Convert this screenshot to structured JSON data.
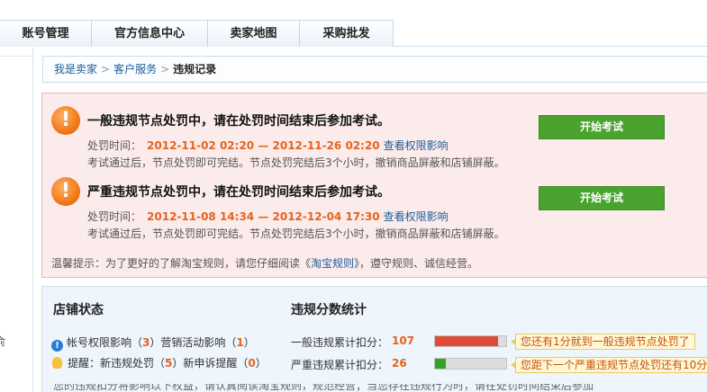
{
  "tabs": [
    "账号管理",
    "官方信息中心",
    "卖家地图",
    "采购批发"
  ],
  "sidebar": {
    "fragment": "俞"
  },
  "breadcrumb": {
    "items": [
      "我是卖家",
      "客户服务"
    ],
    "current": "违规记录",
    "separator": ">"
  },
  "alerts": [
    {
      "title": "一般违规节点处罚中，请在处罚时间结束后参加考试。",
      "time_label": "处罚时间：",
      "time_value": "2012-11-02 02:20 — 2012-11-26 02:20",
      "link": "查看权限影响",
      "desc": "考试通过后，节点处罚即可完结。节点处罚完结后3个小时，撤销商品屏蔽和店铺屏蔽。",
      "button": "开始考试"
    },
    {
      "title": "严重违规节点处罚中，请在处罚时间结束后参加考试。",
      "time_label": "处罚时间：",
      "time_value": "2012-11-08 14:34 — 2012-12-04 17:30",
      "link": "查看权限影响",
      "desc": "考试通过后，节点处罚即可完结。节点处罚完结后3个小时，撤销商品屏蔽和店铺屏蔽。",
      "button": "开始考试"
    }
  ],
  "tip": {
    "prefix": "温馨提示：为了更好的了解淘宝规则，请您仔细阅读《",
    "link": "淘宝规则",
    "suffix": "》，遵守规则、诚信经营。"
  },
  "shop_status": {
    "title": "店铺状态",
    "row1": {
      "label1": "帐号权限影响（",
      "num1": "3",
      "label2": "）营销活动影响（",
      "num2": "1",
      "end": "）"
    },
    "row2": {
      "label1": "提醒：新违规处罚（",
      "num1": "5",
      "label2": "）新申诉提醒（",
      "num2": "0",
      "end": "）"
    }
  },
  "score_stats": {
    "title": "违规分数统计",
    "general": {
      "label": "一般违规累计扣分：",
      "value": "107",
      "fill_percent": 88,
      "callout": "您还有1分就到一般违规节点处罚了"
    },
    "serious": {
      "label": "严重违规累计扣分：",
      "value": "26",
      "fill_percent": 15,
      "callout": "您距下一个严重违规节点处罚还有10分"
    }
  },
  "cut_text": "您的违规扣分将影响以下权益，请认真阅读淘宝规则，规范经营；当您存在违规行为时，请在处罚时间结束后参加考试。"
}
